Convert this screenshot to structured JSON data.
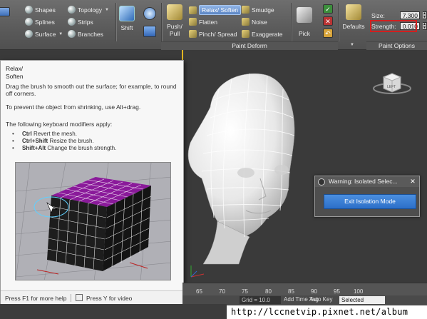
{
  "ribbon": {
    "items": {
      "shapes": "Shapes",
      "splines": "Splines",
      "surface": "Surface",
      "topology": "Topology",
      "strips": "Strips",
      "branches": "Branches",
      "shift": "Shift",
      "push_pull": "Push/\nPull",
      "relax_soften": "Relax/ Soften",
      "flatten": "Flatten",
      "pinch_spread": "Pinch/ Spread",
      "smudge": "Smudge",
      "noise": "Noise",
      "exaggerate": "Exaggerate",
      "pick": "Pick",
      "defaults": "Defaults"
    },
    "panels": {
      "paint_deform": "Paint Deform",
      "paint_options": "Paint Options"
    },
    "size_label": "Size:",
    "size_value": "7.300",
    "strength_label": "Strength:",
    "strength_value": "0.010"
  },
  "tooltip": {
    "title_line1": "Relax/",
    "title_line2": "Soften",
    "desc": "Drag the brush to smooth out the surface; for example, to round off corners.",
    "prevent": "To prevent the object from shrinking, use Alt+drag.",
    "modifiers_intro": "The following keyboard modifiers apply:",
    "modifiers": [
      {
        "key": "Ctrl",
        "text": "Revert the mesh."
      },
      {
        "key": "Ctrl+Shift",
        "text": "Resize the brush."
      },
      {
        "key": "Shift+Alt",
        "text": "Change the brush strength."
      }
    ],
    "footer_left": "Press F1 for more help",
    "footer_right": "Press Y for video"
  },
  "viewcube_label": "LEFT",
  "warning": {
    "title": "Warning: Isolated Selec...",
    "close": "✕",
    "button": "Exit Isolation Mode"
  },
  "timeline": {
    "ticks": [
      "65",
      "70",
      "75",
      "80",
      "85",
      "90",
      "95",
      "100"
    ]
  },
  "status": {
    "grid": "Grid = 10.0",
    "add_time_tag": "Add Time Tag",
    "auto_key": "Auto Key",
    "selected": "Selected"
  },
  "watermark": "http://lccnetvip.pixnet.net/album",
  "colors": {
    "accent_blue": "#3d7fd6",
    "highlight_red": "#d21f1f",
    "viewport_border": "#e2b623",
    "cube_purple": "#8a1a9a"
  }
}
